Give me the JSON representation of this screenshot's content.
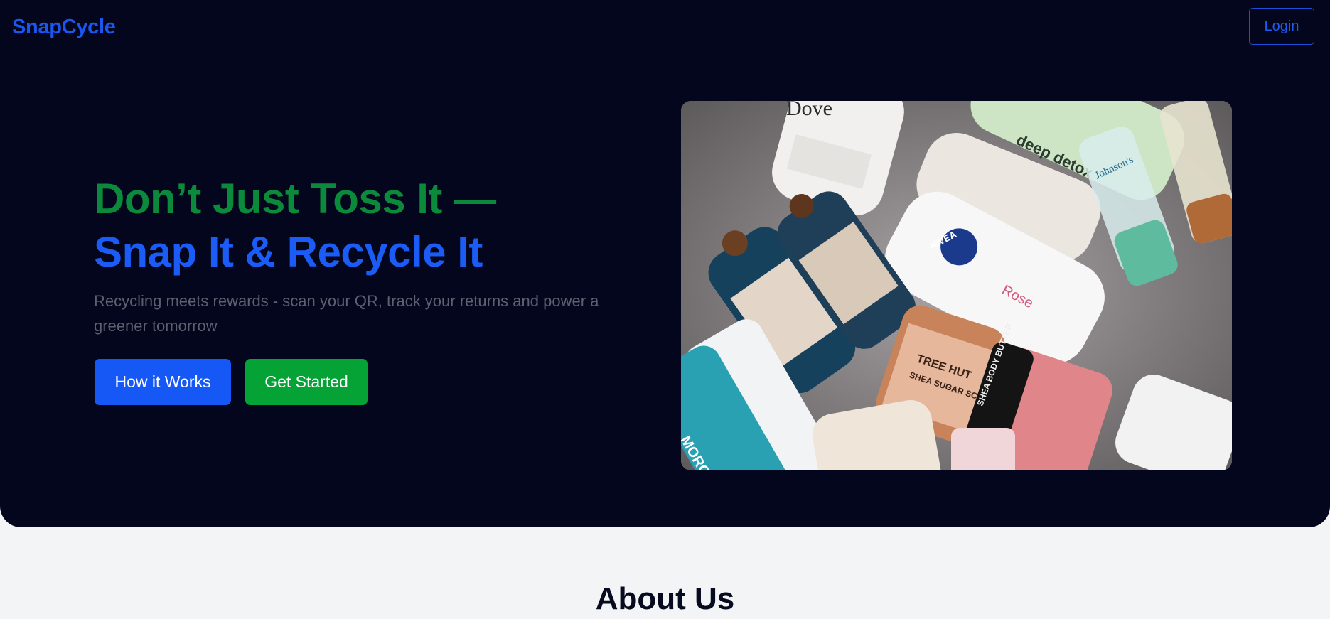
{
  "nav": {
    "brand": "SnapCycle",
    "login_label": "Login"
  },
  "hero": {
    "headline_line1": "Don’t Just Toss It —",
    "headline_line2": "Snap It & Recycle It",
    "subtext": "Recycling meets rewards - scan your QR, track your returns and power a greener tomorrow",
    "how_button_label": "How it Works",
    "start_button_label": "Get Started",
    "image": {
      "description_icon": "product-bottles-photo",
      "labels": [
        "Dove",
        "NIVEA",
        "Rose",
        "TREE HUT",
        "SHEA SUGAR SCRUB",
        "SHEA BODY BUTTER",
        "MOROCCANOIL",
        "Johnson's",
        "deep detox"
      ]
    }
  },
  "about": {
    "title": "About Us"
  },
  "colors": {
    "hero_bg": "#03061c",
    "brand_blue": "#1a56f0",
    "headline_green": "#0a8a3a",
    "headline_blue": "#1a5cf5",
    "btn_blue": "#1558f5",
    "btn_green": "#05a336",
    "page_bg": "#f3f4f6"
  }
}
